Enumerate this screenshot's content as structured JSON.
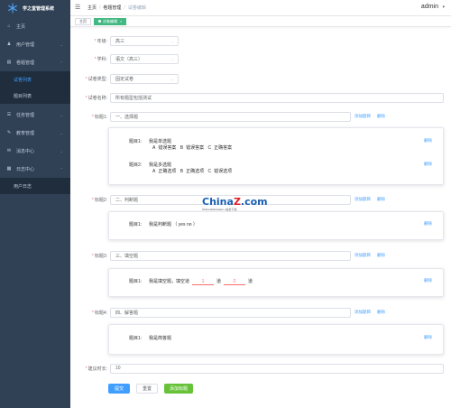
{
  "app": {
    "title": "学之堂管理系统"
  },
  "sidebar": {
    "items": [
      {
        "label": "主页",
        "icon": "home-icon"
      },
      {
        "label": "用户管理",
        "icon": "user-icon"
      },
      {
        "label": "卷题管理",
        "icon": "paper-icon",
        "children": [
          {
            "label": "试卷列表"
          },
          {
            "label": "题目列表"
          }
        ]
      },
      {
        "label": "任务管理",
        "icon": "task-icon"
      },
      {
        "label": "教育管理",
        "icon": "education-icon"
      },
      {
        "label": "消息中心",
        "icon": "message-icon"
      },
      {
        "label": "日志中心",
        "icon": "log-icon",
        "children": [
          {
            "label": "用户日志"
          }
        ]
      }
    ]
  },
  "header": {
    "breadcrumb": [
      "主页",
      "卷题管理",
      "试卷编辑"
    ],
    "user": "admin"
  },
  "tags": [
    {
      "label": "主页"
    },
    {
      "label": "试卷编辑"
    }
  ],
  "form": {
    "grade": {
      "label": "年级:",
      "value": "高三"
    },
    "subject": {
      "label": "学科:",
      "value": "语文（高三）"
    },
    "paper_type": {
      "label": "试卷类型:",
      "value": "固定试卷"
    },
    "paper_name": {
      "label": "试卷名称:",
      "value": "所有题型包括测试"
    },
    "sections": [
      {
        "label": "标题1:",
        "title": "一、选择题",
        "questions": [
          {
            "num": "题目1:",
            "text": "我是单选题",
            "options": [
              "A",
              "错误答案",
              "B",
              "错误答案",
              "C",
              "正确答案"
            ]
          },
          {
            "num": "题目2:",
            "text": "我是多选题",
            "options": [
              "A",
              "正确选项",
              "B",
              "正确选项",
              "C",
              "错误选项"
            ]
          }
        ]
      },
      {
        "label": "标题2:",
        "title": "二、判断题",
        "questions": [
          {
            "num": "题目1:",
            "text": "我是判断题 （ yes   no ）"
          }
        ]
      },
      {
        "label": "标题3:",
        "title": "三、填空题",
        "questions": [
          {
            "num": "题目1:",
            "text_before": "我是填空题，填空道",
            "blank1": "1",
            "text_mid": "道",
            "blank2": "2",
            "text_after": "道"
          }
        ]
      },
      {
        "label": "标题4:",
        "title": "四、解答题",
        "questions": [
          {
            "num": "题目1:",
            "text": "我是简答题"
          }
        ]
      }
    ],
    "add_question": "添加题目",
    "delete": "删除",
    "duration": {
      "label": "建议时长:",
      "value": "10"
    },
    "buttons": {
      "submit": "提交",
      "reset": "重置",
      "add_title": "添加标题"
    }
  },
  "watermark": {
    "main": "China",
    "highlight": "Z",
    "tail": ".com",
    "sub": "China Webmaster | 站长下载"
  },
  "colors": {
    "sidebar_bg": "#304156",
    "primary": "#409eff",
    "success": "#67c23a",
    "active_tag": "#42b983"
  }
}
